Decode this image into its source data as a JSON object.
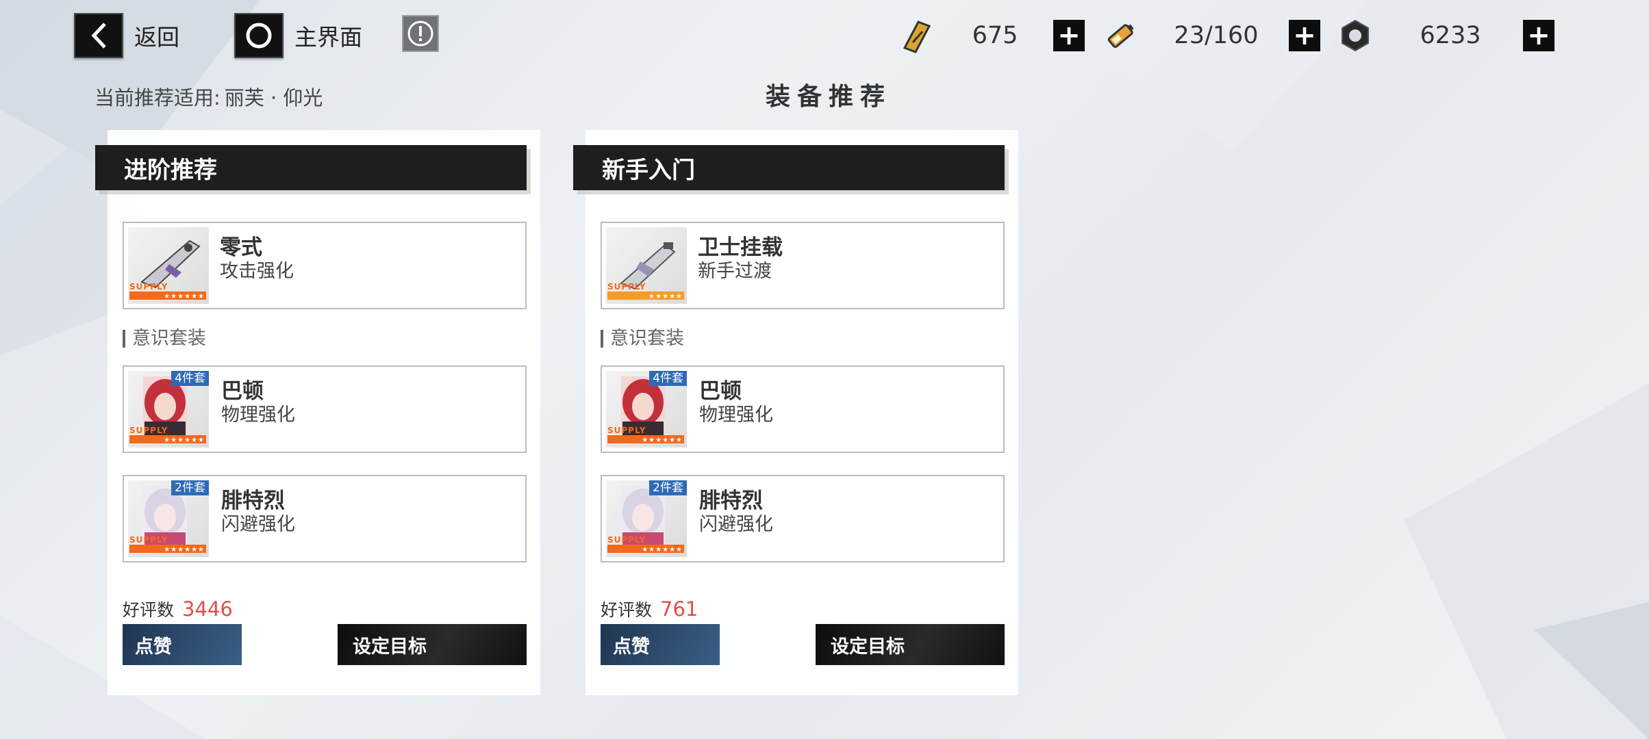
{
  "nav": {
    "back_label": "返回",
    "home_label": "主界面",
    "info_icon": "exclamation-icon"
  },
  "resources": [
    {
      "icon": "blueprint-ticket-icon",
      "value": "675"
    },
    {
      "icon": "battery-icon",
      "value": "23/160"
    },
    {
      "icon": "nut-currency-icon",
      "value": "6233"
    }
  ],
  "subtitle": {
    "prefix": "当前推荐适用:",
    "character": "丽芙 · 仰光"
  },
  "page_title": "装备推荐",
  "cards": [
    {
      "header": "进阶推荐",
      "weapon": {
        "name": "零式",
        "desc": "攻击强化",
        "supply": "SUPPLY",
        "stars": "★★★★★★"
      },
      "section_label": "意识套装",
      "sets": [
        {
          "badge": "4件套",
          "name": "巴顿",
          "desc": "物理强化",
          "supply": "SUPPLY",
          "stars": "★★★★★★"
        },
        {
          "badge": "2件套",
          "name": "腓特烈",
          "desc": "闪避强化",
          "supply": "SUPPLY",
          "stars": "★★★★★★"
        }
      ],
      "rating_label": "好评数",
      "rating_value": "3446",
      "like_label": "点赞",
      "target_label": "设定目标"
    },
    {
      "header": "新手入门",
      "weapon": {
        "name": "卫士挂载",
        "desc": "新手过渡",
        "supply": "SUPPLY",
        "stars": "★★★★★"
      },
      "section_label": "意识套装",
      "sets": [
        {
          "badge": "4件套",
          "name": "巴顿",
          "desc": "物理强化",
          "supply": "SUPPLY",
          "stars": "★★★★★★"
        },
        {
          "badge": "2件套",
          "name": "腓特烈",
          "desc": "闪避强化",
          "supply": "SUPPLY",
          "stars": "★★★★★★"
        }
      ],
      "rating_label": "好评数",
      "rating_value": "761",
      "like_label": "点赞",
      "target_label": "设定目标"
    }
  ],
  "colors": {
    "accent_orange": "#f26a1b",
    "badge_blue": "#2f6ab4",
    "rating_red": "#e44d4d",
    "like_blue": "#2e4d70"
  }
}
